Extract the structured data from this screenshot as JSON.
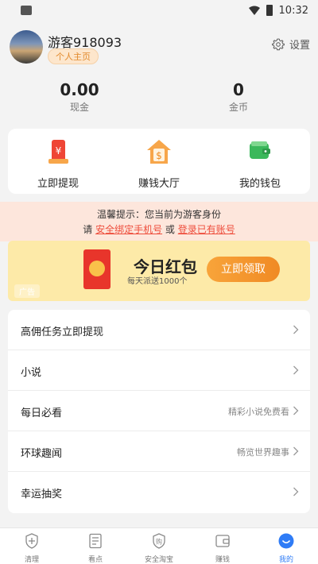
{
  "status_bar": {
    "time": "10:32"
  },
  "profile": {
    "username": "游客918093",
    "homepage_label": "个人主页",
    "settings_label": "设置"
  },
  "stats": [
    {
      "value": "0.00",
      "label": "现金"
    },
    {
      "value": "0",
      "label": "金币"
    }
  ],
  "quick_actions": [
    {
      "label": "立即提现",
      "icon": "withdraw-icon"
    },
    {
      "label": "赚钱大厅",
      "icon": "earning-hall-icon"
    },
    {
      "label": "我的钱包",
      "icon": "wallet-icon"
    }
  ],
  "notice": {
    "line1": "温馨提示：您当前为游客身份",
    "prefix": "请",
    "link1": "安全绑定手机号",
    "middle": "或",
    "link2": "登录已有账号"
  },
  "ad": {
    "title": "今日红包",
    "subtitle": "每天派送1000个",
    "button": "立即领取",
    "tag": "广告"
  },
  "menu": [
    {
      "label": "高佣任务立即提现",
      "sub": ""
    },
    {
      "label": "小说",
      "sub": ""
    },
    {
      "label": "每日必看",
      "sub": "精彩小说免费看"
    },
    {
      "label": "环球趣闻",
      "sub": "畅览世界趣事"
    },
    {
      "label": "幸运抽奖",
      "sub": ""
    }
  ],
  "bottom_nav": [
    {
      "label": "清理",
      "icon": "shield-plus-icon"
    },
    {
      "label": "看点",
      "icon": "news-icon"
    },
    {
      "label": "安全淘宝",
      "icon": "shop-shield-icon"
    },
    {
      "label": "赚钱",
      "icon": "wallet-icon"
    },
    {
      "label": "我的",
      "icon": "profile-icon",
      "active": true
    }
  ],
  "colors": {
    "accent": "#f08a24",
    "notice_link": "#ee4d3c",
    "nav_active": "#2f7cf6"
  }
}
